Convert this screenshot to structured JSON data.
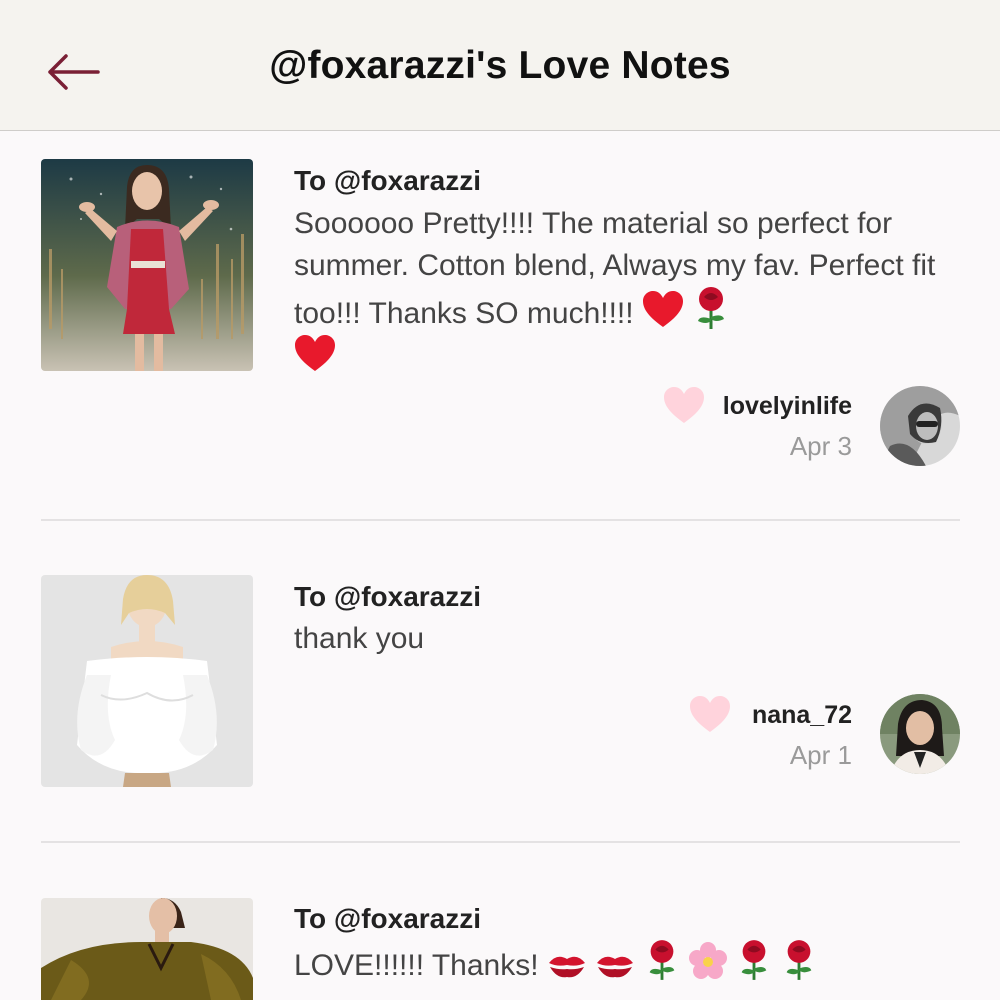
{
  "header": {
    "title": "@foxarazzi's Love Notes",
    "back_icon": "arrow-left-icon",
    "accent_color": "#7a1f35"
  },
  "notes": [
    {
      "to": "To @foxarazzi",
      "message": "Soooooo Pretty!!!! The material so perfect for summer. Cotton blend, Always my fav. Perfect fit too!!! Thanks SO much!!!!",
      "emojis": [
        "red-heart",
        "rose",
        "red-heart"
      ],
      "username": "lovelyinlife",
      "date": "Apr 3"
    },
    {
      "to": "To @foxarazzi",
      "message": "thank you",
      "emojis": [],
      "username": "nana_72",
      "date": "Apr 1"
    },
    {
      "to": "To @foxarazzi",
      "message": "LOVE!!!!!! Thanks!",
      "emojis": [
        "kiss-mark",
        "kiss-mark",
        "rose",
        "cherry-blossom",
        "rose",
        "rose"
      ]
    }
  ],
  "colors": {
    "like_heart": "#ffd3dc",
    "emoji_heart": "#e8192c",
    "rose": "#c8102e"
  }
}
